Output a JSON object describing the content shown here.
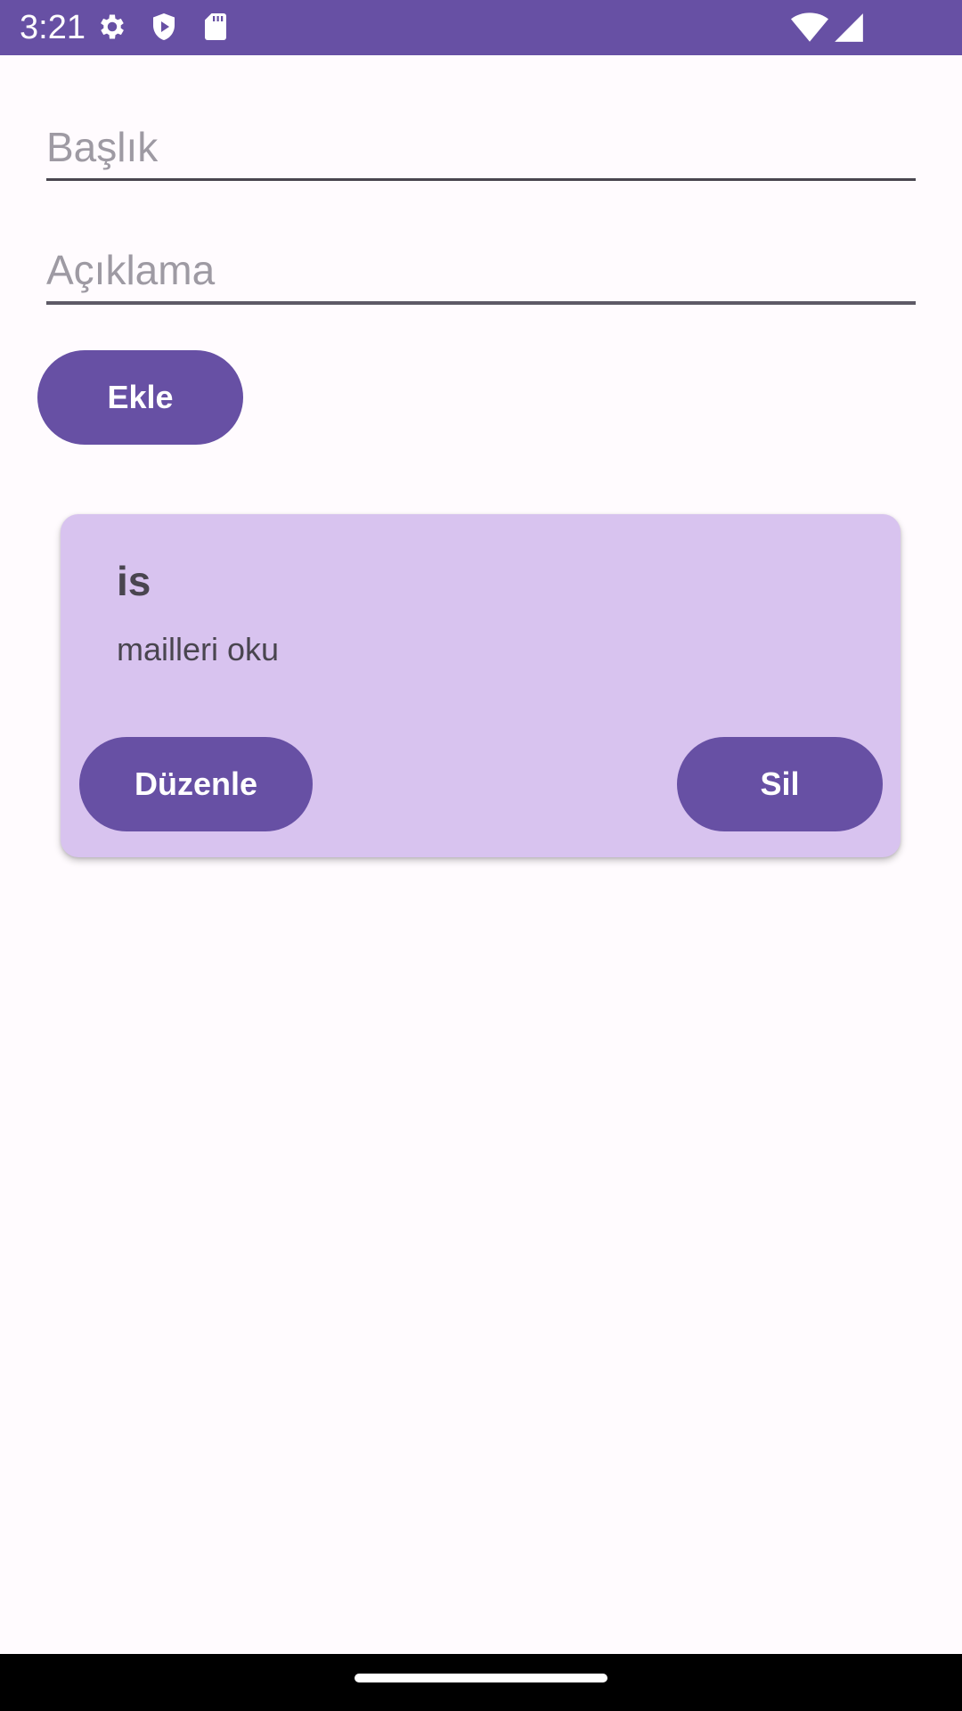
{
  "status_bar": {
    "time": "3:21",
    "background_color": "#6750A4",
    "icons_left": [
      "settings-gear-icon",
      "shield-play-icon",
      "sd-card-icon"
    ],
    "icons_right": [
      "wifi-icon",
      "cell-signal-icon"
    ]
  },
  "form": {
    "title_placeholder": "Başlık",
    "title_value": "",
    "description_placeholder": "Açıklama",
    "description_value": "",
    "add_label": "Ekle"
  },
  "notes": [
    {
      "title": "is",
      "description": "mailleri oku",
      "edit_label": "Düzenle",
      "delete_label": "Sil"
    }
  ],
  "colors": {
    "primary": "#6750A4",
    "card": "#D8C3EF",
    "background": "#FFFBFE",
    "on_surface_variant": "#49454F"
  }
}
